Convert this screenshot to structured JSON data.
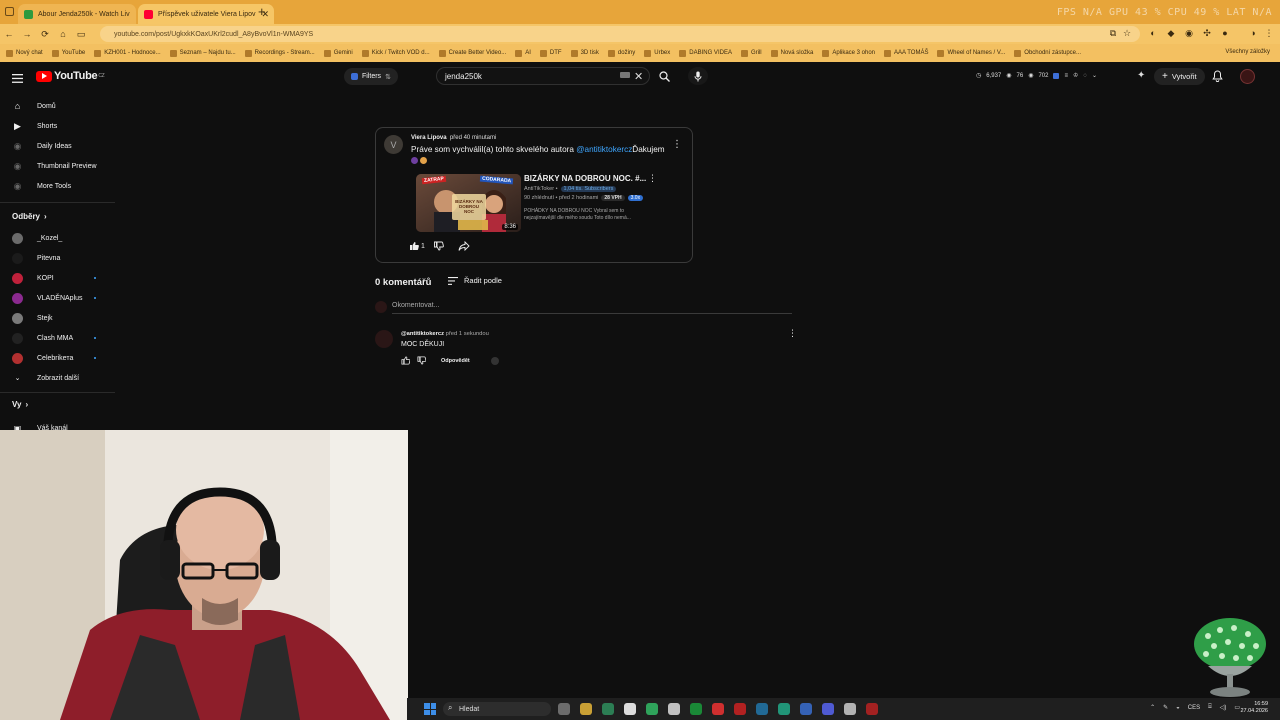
{
  "browser": {
    "tabs": [
      {
        "label": "Abour Jenda250k - Watch Liv",
        "color": "#2e9a3e"
      },
      {
        "label": "Příspěvek uživatele Viera Lipov",
        "color": "#ff0033"
      }
    ],
    "hud": "FPS N/A   GPU 43 %   CPU 49 %   LAT N/A",
    "url": "youtube.com/post/UgkxkKOaxUKrl2cudl_A8yBvoVl1n-WMA9YS",
    "bookmarks": [
      "Nový chat",
      "YouTube",
      "KZH001 - Hodnoce...",
      "Seznam – Najdu tu...",
      "Recordings - Stream...",
      "Gemini",
      "Kick / Twitch VOD d...",
      "Create Better Video...",
      "AI",
      "DTF",
      "3D tisk",
      "dožiny",
      "Urbex",
      "DABING VIDEA",
      "Grill",
      "Nová složka",
      "Aplikace 3 ohon",
      "AAA TOMÁŠ",
      "Wheel of Names / V...",
      "Obchodní zástupce..."
    ],
    "bookmarks_right": "Všechny záložky"
  },
  "header": {
    "logo": "YouTube",
    "logo_sup": "CZ",
    "filters": "Filters",
    "search_value": "jenda250k",
    "stats": [
      "6,937",
      "76",
      "702"
    ],
    "create": "Vytvořit"
  },
  "sidebar": {
    "items": [
      {
        "label": "Domů",
        "icon": "home-icon"
      },
      {
        "label": "Shorts",
        "icon": "shorts-icon"
      },
      {
        "label": "Daily Ideas",
        "icon": "ideas-icon"
      },
      {
        "label": "Thumbnail Preview",
        "icon": "thumbnail-icon"
      },
      {
        "label": "More Tools",
        "icon": "tools-icon"
      }
    ],
    "subs_title": "Odběry",
    "subs": [
      {
        "label": "_Kozel_",
        "color": "#6b6b6b",
        "dot": false
      },
      {
        "label": "Pitevna",
        "color": "#1b1b1b",
        "dot": false
      },
      {
        "label": "KOPI",
        "color": "#c0213b",
        "dot": true
      },
      {
        "label": "VLADĚNAplus",
        "color": "#8b2a8f",
        "dot": true
      },
      {
        "label": "Stejk",
        "color": "#7a7a7a",
        "dot": false
      },
      {
        "label": "Clash MMA",
        "color": "#222222",
        "dot": true
      },
      {
        "label": "Celebrikета",
        "color": "#b23030",
        "dot": true
      }
    ],
    "show_more": "Zobrazit další",
    "you_title": "Vy",
    "partial": "Váš kanál"
  },
  "post": {
    "author": "Viera Lipova",
    "time": "před 40 minutami",
    "text_before": "Práve som vychválil(a) tohto skvelého autora ",
    "mention": "@antitiktokercz",
    "text_after": "Ďakujem",
    "avatar_letter": "V",
    "likes": "1",
    "video": {
      "title": "BIZÁRKY NA DOBROU NOC. #...",
      "channel": "AntiTikToker",
      "subs": "1,04 tis. Subscribers",
      "meta": "90 zhlédnutí • před 2 hodinami",
      "vph": "28 VPH",
      "ratio": "3.0x",
      "duration": "8:36",
      "desc": "POHÁDKY NA DOBROU NOC Vybral sem to nejzajímavější dle mého soudu Toto dílo nemá...",
      "thumb_text1": "ZATRAP",
      "thumb_text2": "CODARADA",
      "thumb_text3": "BIZÁRKY NA DOBROU NOC"
    }
  },
  "comments": {
    "count": "0 komentářů",
    "sort": "Řadit podle",
    "placeholder": "Okomentovat...",
    "items": [
      {
        "author": "@antitiktokercz",
        "time": "před 1 sekundou",
        "text": "MOC DĚKUJI",
        "reply": "Odpovědět"
      }
    ]
  },
  "taskbar": {
    "search": "Hledat",
    "lang": "CES",
    "time": "16:59",
    "date": "27.04.2026"
  },
  "colors": {
    "accent": "#3ea6ff",
    "youtube_red": "#ff0000",
    "chrome_orange": "#e7a53a"
  }
}
